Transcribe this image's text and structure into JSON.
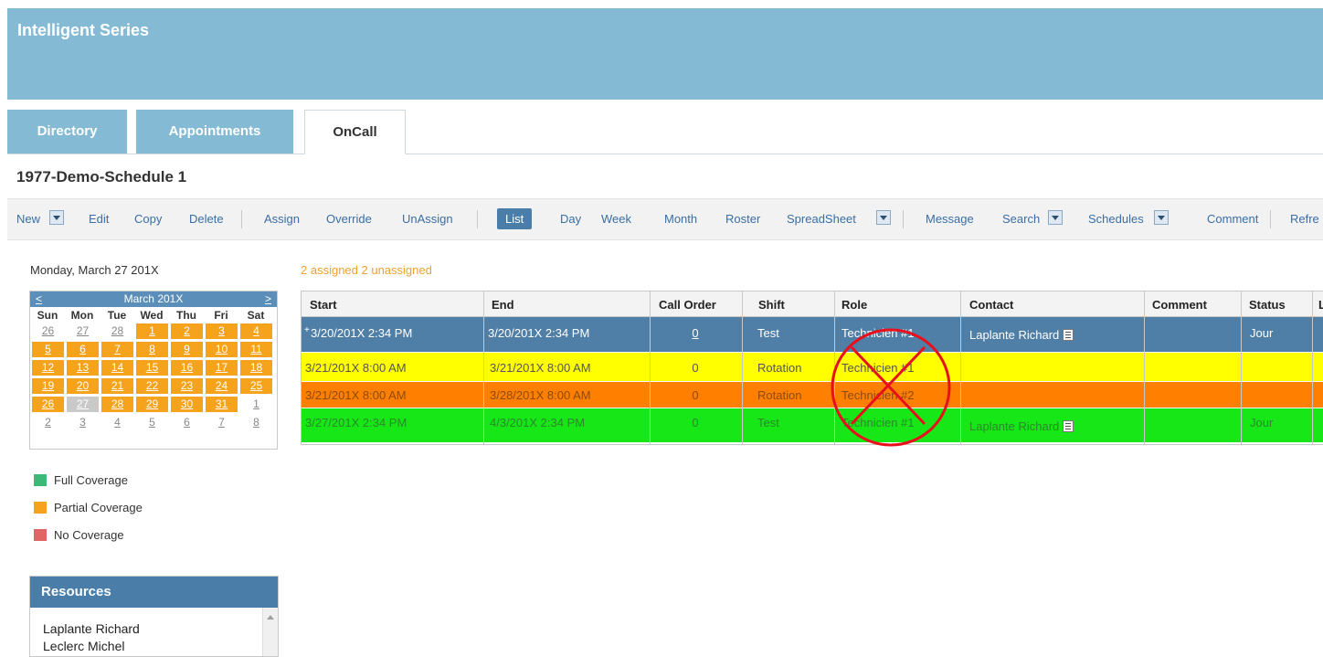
{
  "app": {
    "title": "Intelligent Series"
  },
  "tabs": [
    {
      "label": "Directory"
    },
    {
      "label": "Appointments"
    },
    {
      "label": "OnCall",
      "active": true
    }
  ],
  "schedule": {
    "title": "1977-Demo-Schedule 1"
  },
  "toolbar": {
    "new": "New",
    "edit": "Edit",
    "copy": "Copy",
    "delete": "Delete",
    "assign": "Assign",
    "override": "Override",
    "unassign": "UnAssign",
    "list": "List",
    "day": "Day",
    "week": "Week",
    "month": "Month",
    "roster": "Roster",
    "spreadsheet": "SpreadSheet",
    "message": "Message",
    "search": "Search",
    "schedules": "Schedules",
    "comment": "Comment",
    "refresh": "Refre"
  },
  "left": {
    "date_label": "Monday, March 27 201X",
    "calendar": {
      "prev": "<",
      "next": ">",
      "month": "March 201X",
      "dow": [
        "Sun",
        "Mon",
        "Tue",
        "Wed",
        "Thu",
        "Fri",
        "Sat"
      ],
      "weeks": [
        [
          "26",
          "27",
          "28",
          "1",
          "2",
          "3",
          "4"
        ],
        [
          "5",
          "6",
          "7",
          "8",
          "9",
          "10",
          "11"
        ],
        [
          "12",
          "13",
          "14",
          "15",
          "16",
          "17",
          "18"
        ],
        [
          "19",
          "20",
          "21",
          "22",
          "23",
          "24",
          "25"
        ],
        [
          "26",
          "27",
          "28",
          "29",
          "30",
          "31",
          "1"
        ],
        [
          "2",
          "3",
          "4",
          "5",
          "6",
          "7",
          "8"
        ]
      ],
      "selected": "27"
    },
    "legend": [
      {
        "label": "Full Coverage",
        "color": "#3cb878"
      },
      {
        "label": "Partial Coverage",
        "color": "#f5a31c"
      },
      {
        "label": "No Coverage",
        "color": "#e06666"
      }
    ],
    "resources": {
      "title": "Resources",
      "items": [
        "Laplante Richard",
        "Leclerc Michel"
      ]
    }
  },
  "grid": {
    "summary": "2 assigned 2 unassigned",
    "columns": [
      "Start",
      "End",
      "Call Order",
      "Shift",
      "Role",
      "Contact",
      "Comment",
      "Status",
      "L"
    ],
    "rows": [
      {
        "expander": "+",
        "start": "3/20/201X 2:34 PM",
        "end": "3/20/201X 2:34 PM",
        "call_order": "0",
        "shift": "Test",
        "role": "Technicien #1",
        "contact": "Laplante Richard",
        "comment": "",
        "status": "Jour",
        "color": "#4f7fa6"
      },
      {
        "start": "3/21/201X 8:00 AM",
        "end": "3/21/201X 8:00 AM",
        "call_order": "0",
        "shift": "Rotation",
        "role": "Technicien #1",
        "contact": "",
        "comment": "",
        "status": "",
        "color": "#ffff00"
      },
      {
        "start": "3/21/201X 8:00 AM",
        "end": "3/28/201X 8:00 AM",
        "call_order": "0",
        "shift": "Rotation",
        "role": "Technicien #2",
        "contact": "",
        "comment": "",
        "status": "",
        "color": "#ff8000"
      },
      {
        "start": "3/27/201X 2:34 PM",
        "end": "4/3/201X 2:34 PM",
        "call_order": "0",
        "shift": "Test",
        "role": "Technicien #1",
        "contact": "Laplante Richard",
        "comment": "",
        "status": "Jour",
        "color": "#17e617"
      }
    ]
  },
  "annotation": {
    "color": "#e8101c"
  }
}
